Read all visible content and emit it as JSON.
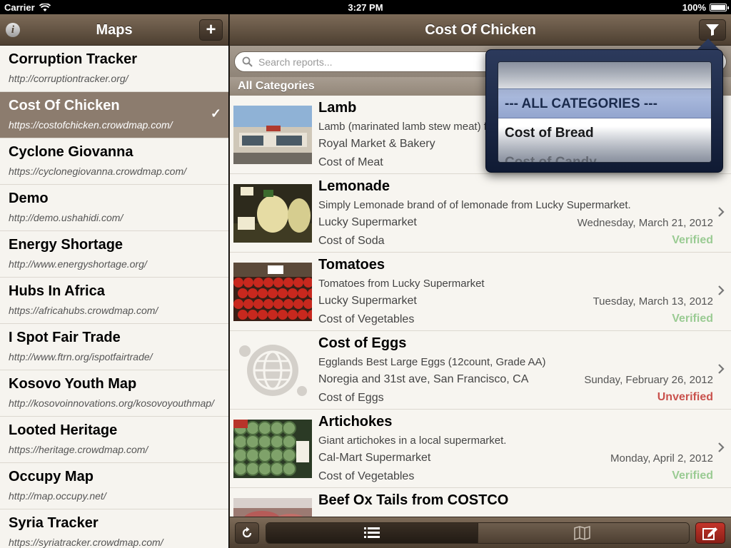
{
  "status_bar": {
    "carrier": "Carrier",
    "time": "3:27 PM",
    "battery": "100%",
    "battery_level": 1.0
  },
  "sidebar": {
    "title": "Maps",
    "info_label": "i",
    "add_label": "+",
    "items": [
      {
        "name": "Corruption Tracker",
        "url": "http://corruptiontracker.org/"
      },
      {
        "name": "Cost Of Chicken",
        "url": "https://costofchicken.crowdmap.com/",
        "selected": true,
        "check": "✓"
      },
      {
        "name": "Cyclone Giovanna",
        "url": "https://cyclonegiovanna.crowdmap.com/"
      },
      {
        "name": "Demo",
        "url": "http://demo.ushahidi.com/"
      },
      {
        "name": "Energy Shortage",
        "url": "http://www.energyshortage.org/"
      },
      {
        "name": "Hubs In Africa",
        "url": "https://africahubs.crowdmap.com/"
      },
      {
        "name": "I Spot Fair Trade",
        "url": "http://www.ftrn.org/ispotfairtrade/"
      },
      {
        "name": "Kosovo Youth Map",
        "url": "http://kosovoinnovations.org/kosovoyouthmap/"
      },
      {
        "name": "Looted Heritage",
        "url": "https://heritage.crowdmap.com/"
      },
      {
        "name": "Occupy Map",
        "url": "http://map.occupy.net/"
      },
      {
        "name": "Syria Tracker",
        "url": "https://syriatracker.crowdmap.com/"
      }
    ]
  },
  "main": {
    "title": "Cost Of Chicken",
    "search": {
      "placeholder": "Search reports...",
      "value": ""
    },
    "section_header": "All Categories",
    "reports": [
      {
        "title": "Lamb",
        "description": "Lamb (marinated lamb stew meat) for",
        "location": "Royal Market & Bakery",
        "category": "Cost of Meat",
        "date": "",
        "status": "",
        "thumb": "storefront"
      },
      {
        "title": "Lemonade",
        "description": "Simply Lemonade brand of of lemonade from Lucky Supermarket.",
        "location": "Lucky Supermarket",
        "category": "Cost of Soda",
        "date": "Wednesday, March 21, 2012",
        "status": "Verified",
        "thumb": "bottles"
      },
      {
        "title": "Tomatoes",
        "description": "Tomatoes from Lucky Supermarket",
        "location": "Lucky Supermarket",
        "category": "Cost of Vegetables",
        "date": "Tuesday, March 13, 2012",
        "status": "Verified",
        "thumb": "tomatoes"
      },
      {
        "title": "Cost of Eggs",
        "description": "Egglands Best Large Eggs (12count, Grade AA)",
        "location": "Noregia and 31st ave, San Francisco, CA",
        "category": "Cost of Eggs",
        "date": "Sunday, February 26, 2012",
        "status": "Unverified",
        "thumb": "placeholder-globe"
      },
      {
        "title": "Artichokes",
        "description": "Giant artichokes in a local supermarket.",
        "location": "Cal-Mart Supermarket",
        "category": "Cost of Vegetables",
        "date": "Monday, April 2, 2012",
        "status": "Verified",
        "thumb": "artichokes"
      },
      {
        "title": "Beef Ox Tails from COSTCO",
        "description": "",
        "location": "",
        "category": "",
        "date": "",
        "status": "",
        "thumb": "meat"
      }
    ]
  },
  "filter_popover": {
    "picker_rows": [
      {
        "label": ""
      },
      {
        "label": "--- ALL CATEGORIES ---",
        "selected": true
      },
      {
        "label": "Cost of Bread"
      },
      {
        "label": "Cost of Candy"
      }
    ]
  },
  "toolbar": {
    "refresh_icon": "refresh-icon",
    "segments": [
      {
        "icon": "list-icon",
        "active": true
      },
      {
        "icon": "map-icon",
        "active": false
      }
    ],
    "compose_icon": "compose-icon"
  },
  "colors": {
    "nav_brown": "#5e4d3d",
    "selected_row": "#8c7c6e",
    "verified": "#9acb93",
    "unverified": "#c9524d",
    "compose_red": "#b02d23",
    "popover_navy": "#1d2a48"
  }
}
